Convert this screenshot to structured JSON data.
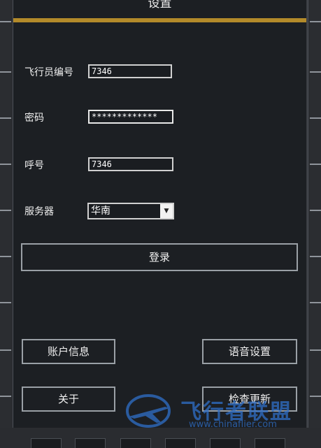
{
  "header": {
    "title": "设置"
  },
  "form": {
    "pilot_id_label": "飞行员编号",
    "pilot_id_value": "7346",
    "password_label": "密码",
    "password_value": "*************",
    "callsign_label": "呼号",
    "callsign_value": "7346",
    "server_label": "服务器",
    "server_value": "华南"
  },
  "buttons": {
    "login": "登录",
    "account_info": "账户信息",
    "voice_settings": "语音设置",
    "about": "关于",
    "check_update": "检查更新"
  },
  "watermark": {
    "brand": "飞行者联盟",
    "url": "www.chinaflier.com"
  },
  "colors": {
    "accent": "#b38a2a",
    "panel": "#1c1f23",
    "watermark": "#2f6fc9"
  }
}
